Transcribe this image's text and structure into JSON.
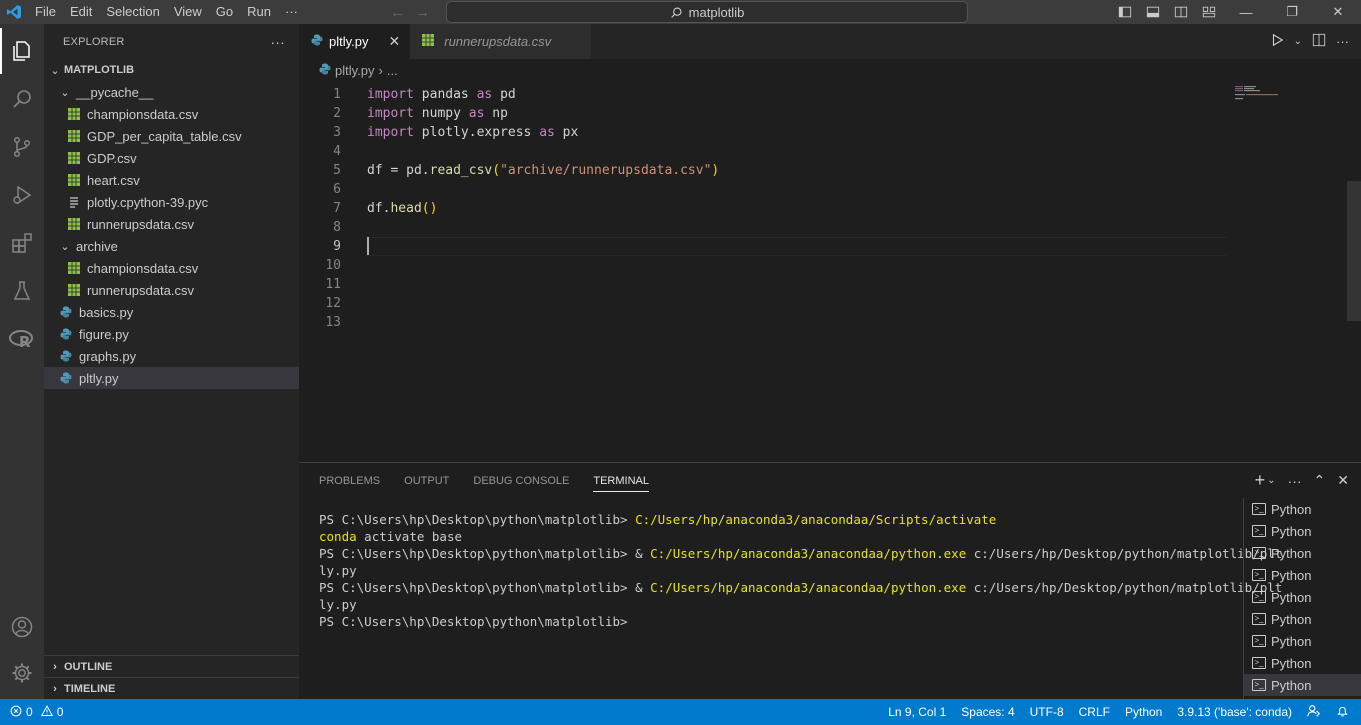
{
  "titlebar": {
    "menu": [
      "File",
      "Edit",
      "Selection",
      "View",
      "Go",
      "Run",
      "···"
    ],
    "search_text": "matplotlib"
  },
  "explorer": {
    "title": "EXPLORER",
    "more": "···",
    "root": "MATPLOTLIB",
    "items": [
      {
        "label": "__pycache__",
        "kind": "folder"
      },
      {
        "label": "championsdata.csv",
        "kind": "csv"
      },
      {
        "label": "GDP_per_capita_table.csv",
        "kind": "csv"
      },
      {
        "label": "GDP.csv",
        "kind": "csv"
      },
      {
        "label": "heart.csv",
        "kind": "csv"
      },
      {
        "label": "plotly.cpython-39.pyc",
        "kind": "pyc"
      },
      {
        "label": "runnerupsdata.csv",
        "kind": "csv"
      },
      {
        "label": "archive",
        "kind": "folder"
      },
      {
        "label": "championsdata.csv",
        "kind": "csv"
      },
      {
        "label": "runnerupsdata.csv",
        "kind": "csv"
      },
      {
        "label": "basics.py",
        "kind": "py"
      },
      {
        "label": "figure.py",
        "kind": "py"
      },
      {
        "label": "graphs.py",
        "kind": "py"
      },
      {
        "label": "pltly.py",
        "kind": "py"
      }
    ],
    "outline": "OUTLINE",
    "timeline": "TIMELINE"
  },
  "tabs": [
    {
      "label": "pltly.py"
    },
    {
      "label": "runnerupsdata.csv"
    }
  ],
  "breadcrumb": {
    "file": "pltly.py",
    "rest": "..."
  },
  "editor": {
    "line_numbers": [
      "1",
      "2",
      "3",
      "4",
      "5",
      "6",
      "7",
      "8",
      "9",
      "10",
      "11",
      "12",
      "13"
    ],
    "l1": {
      "kw1": "import",
      "mod": " pandas ",
      "kw2": "as",
      "alias": " pd"
    },
    "l2": {
      "kw1": "import",
      "mod": " numpy ",
      "kw2": "as",
      "alias": " np"
    },
    "l3": {
      "kw1": "import",
      "mod": " plotly.express ",
      "kw2": "as",
      "alias": " px"
    },
    "l5": {
      "pre": "df = pd.",
      "fn": "read_csv",
      "open": "(",
      "str": "\"archive/runnerupsdata.csv\"",
      "close": ")"
    },
    "l7": {
      "pre": "df.",
      "fn": "head",
      "parens": "()"
    }
  },
  "panel": {
    "tabs": [
      "PROBLEMS",
      "OUTPUT",
      "DEBUG CONSOLE",
      "TERMINAL"
    ],
    "terminal": {
      "prompt": "PS C:\\Users\\hp\\Desktop\\python\\matplotlib> ",
      "cmd1": "C:/Users/hp/anaconda3/anacondaa/Scripts/activate",
      "cmd2": "conda",
      "cmd2_rest": " activate base",
      "amp": "& ",
      "py": "C:/Users/hp/anaconda3/anacondaa/python.exe",
      "arg": " c:/Users/hp/Desktop/python/matplotlib/plt",
      "wrap": "ly.py"
    },
    "terminal_list": [
      "Python",
      "Python",
      "Python",
      "Python",
      "Python",
      "Python",
      "Python",
      "Python",
      "Python"
    ]
  },
  "statusbar": {
    "errors": "0",
    "warnings": "0",
    "position": "Ln 9, Col 1",
    "spaces": "Spaces: 4",
    "encoding": "UTF-8",
    "eol": "CRLF",
    "language": "Python",
    "interpreter": "3.9.13 ('base': conda)"
  }
}
